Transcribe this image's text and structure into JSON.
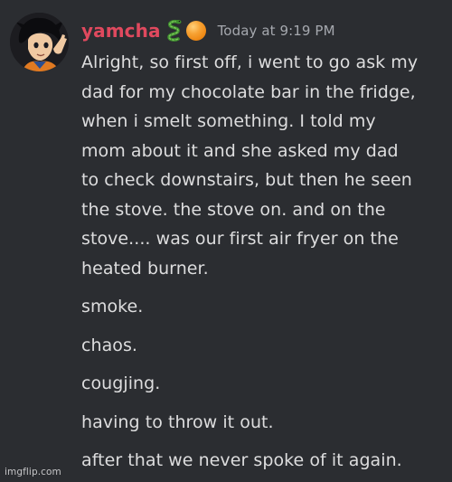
{
  "message": {
    "username": "yamcha",
    "role_icon": "snake-icon",
    "badge_icon": "orange-orb-icon",
    "timestamp": "Today at 9:19 PM",
    "lines": [
      "Alright, so first off, i went to go ask my",
      "dad for my chocolate bar in the fridge,",
      "when i smelt something. I told my",
      "mom about it and she asked my dad",
      "to check downstairs, but then he seen",
      "the stove. the stove on. and on the",
      "stove.... was our first air fryer on the",
      "heated burner."
    ],
    "short_lines": [
      "smoke.",
      "chaos.",
      "cougjing.",
      "having to throw it out.",
      "after that we never spoke of it again."
    ]
  },
  "watermark": "imgflip.com",
  "colors": {
    "background": "#2b2d31",
    "username": "#e0495e",
    "text": "#ddddde",
    "timestamp": "#a5a8ae"
  }
}
